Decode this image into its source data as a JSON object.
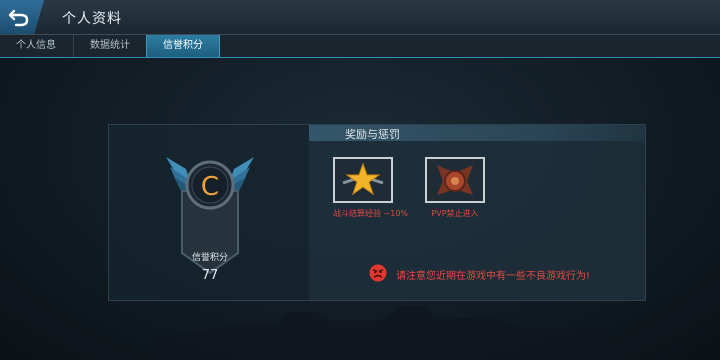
{
  "header": {
    "title": "个人资料",
    "back_icon": "back-arrow-icon"
  },
  "tabs": [
    {
      "label": "个人信息",
      "active": false
    },
    {
      "label": "数据统计",
      "active": false
    },
    {
      "label": "信誉积分",
      "active": true
    }
  ],
  "credit": {
    "grade": "C",
    "label": "信誉积分",
    "score": "77"
  },
  "rewards_section": {
    "title": "奖励与惩罚",
    "items": [
      {
        "icon": "gold-star-icon",
        "caption": "战斗结算经验 −10%"
      },
      {
        "icon": "pvp-ban-emblem-icon",
        "caption": "PVP禁止进入"
      }
    ]
  },
  "warning": {
    "icon": "angry-face-icon",
    "text": "请注意您近期在游戏中有一些不良游戏行为!"
  },
  "colors": {
    "accent": "#2c7ea3",
    "warning": "#e8473c",
    "grade_letter": "#f0a23a"
  }
}
